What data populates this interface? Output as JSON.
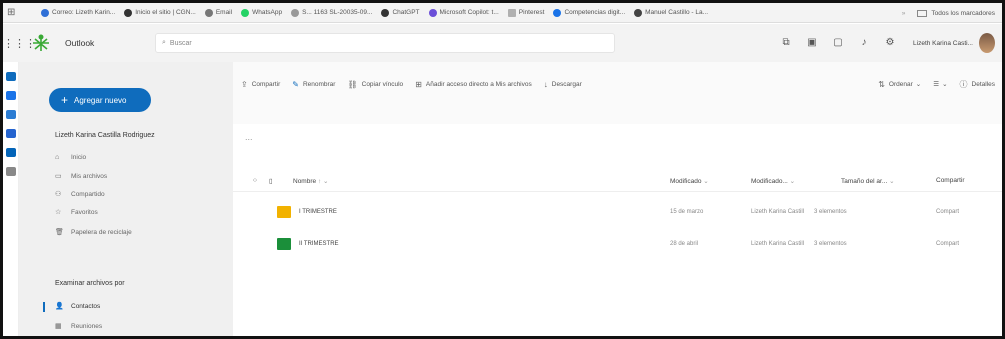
{
  "bookmarks": {
    "items": [
      {
        "label": "Correo: Lizeth Karin...",
        "color": "#2f6fd6"
      },
      {
        "label": "Inicio el sitio | CGN...",
        "color": "#333333"
      },
      {
        "label": "Email",
        "color": "#777777"
      },
      {
        "label": "WhatsApp",
        "color": "#25d366"
      },
      {
        "label": "S... 1163 SL-20035-09...",
        "color": "#999999"
      },
      {
        "label": "ChatGPT",
        "color": "#333333"
      },
      {
        "label": "Microsoft Copilot: t...",
        "color": "#6b4fd8"
      },
      {
        "label": "Pinterest",
        "color": "#b0b0b0"
      },
      {
        "label": "Competencias digit...",
        "color": "#1a73e8"
      },
      {
        "label": "Manuel Castillo - La...",
        "color": "#444444"
      }
    ],
    "more": "»",
    "all_favorites": "Todos los marcadores"
  },
  "header": {
    "app_name": "Outlook",
    "search_placeholder": "Buscar",
    "user_name": "Lizeth Karina Casti..."
  },
  "nav": {
    "new_button": "Agregar nuevo",
    "owner": "Lizeth Karina Castilla Rodriguez",
    "items": [
      {
        "label": "Inicio",
        "icon": "⌂"
      },
      {
        "label": "Mis archivos",
        "icon": "▭"
      },
      {
        "label": "Compartido",
        "icon": "⚇"
      },
      {
        "label": "Favoritos",
        "icon": "☆"
      },
      {
        "label": "Papelera de reciclaje",
        "icon": "🗑"
      }
    ],
    "browse_section": "Examinar archivos por",
    "browse_items": [
      {
        "label": "Contactos",
        "icon": "👤"
      },
      {
        "label": "Reuniones",
        "icon": "▦"
      }
    ]
  },
  "toolbar": {
    "actions": [
      {
        "label": "Compartir",
        "icon": "⇪"
      },
      {
        "label": "Renombrar",
        "icon": "✎"
      },
      {
        "label": "Copiar vínculo",
        "icon": "⛓"
      },
      {
        "label": "Añadir acceso directo a Mis archivos",
        "icon": "⊞"
      },
      {
        "label": "Descargar",
        "icon": "↓"
      }
    ],
    "sort": "Ordenar",
    "view": "☰",
    "details": "Detalles"
  },
  "breadcrumb": "...",
  "table": {
    "columns": {
      "name": "Nombre",
      "modified": "Modificado",
      "modified_by": "Modificado...",
      "size": "Tamaño del ar...",
      "sharing": "Compartir"
    },
    "rows": [
      {
        "name": "I TRIMESTRE",
        "modified": "15 de marzo",
        "modified_by": "Lizeth Karina Castill",
        "size": "3 elementos",
        "sharing": "Compart",
        "icon_color": "#f2b200"
      },
      {
        "name": "II TRIMESTRE",
        "modified": "28 de abril",
        "modified_by": "Lizeth Karina Castill",
        "size": "3 elementos",
        "sharing": "Compart",
        "icon_color": "#1b8f3a"
      }
    ]
  },
  "colors": {
    "accent": "#0f6cbd"
  }
}
